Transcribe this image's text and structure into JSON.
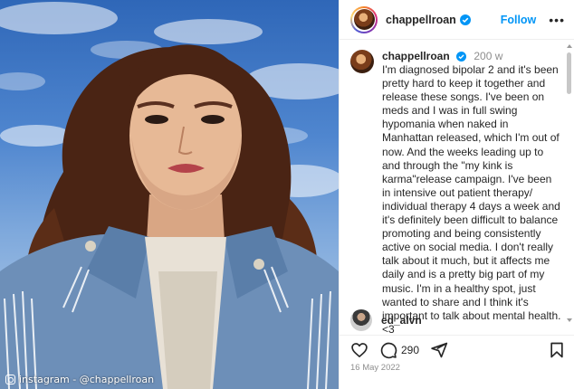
{
  "post": {
    "username": "chappellroan",
    "follow_label": "Follow",
    "more_label": "•••",
    "caption_time": "200 w",
    "caption_text": "I'm diagnosed bipolar 2  and it's been pretty hard to keep it together and release these songs. I've been on meds and I was in full swing hypomania when naked in Manhattan released, which I'm out of now. And the weeks leading up to and through the \"my kink is karma\"release campaign. I've been in intensive out patient therapy/ individual therapy 4 days a week and it's definitely been difficult to balance promoting and being consistently active on social media.  I don't really talk about it much, but it affects me daily and is a pretty big part of my music. I'm in a healthy spot, just wanted to share and I think it's important to talk about mental health. <3",
    "comment_username": "ed_alvn",
    "comment_count": "290",
    "date": "16 May 2022"
  },
  "photo": {
    "watermark": "instagram - @chappellroan"
  },
  "icons": {
    "like": "heart-icon",
    "comment": "comment-bubble-icon",
    "share": "paper-plane-icon",
    "save": "bookmark-icon",
    "verified": "verified-badge-icon"
  },
  "colors": {
    "accent": "#0095f6",
    "muted": "#8e8e8e",
    "text": "#262626"
  }
}
